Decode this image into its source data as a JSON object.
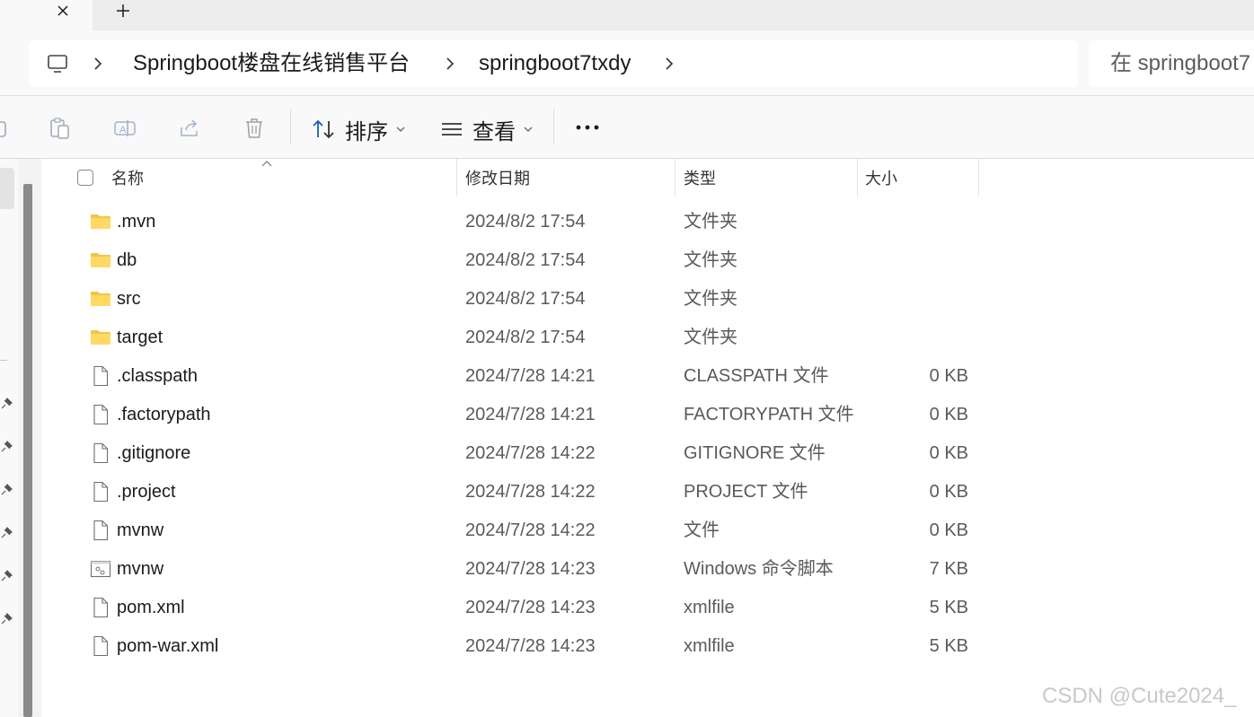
{
  "tabs": {
    "close_glyph": "✕",
    "new_tab_glyph": "+"
  },
  "address": {
    "crumbs": [
      "Springboot楼盘在线销售平台",
      "springboot7txdy"
    ],
    "search_placeholder": "在 springboot7"
  },
  "toolbar": {
    "sort_label": "排序",
    "view_label": "查看",
    "more_label": "···"
  },
  "columns": {
    "name": "名称",
    "modified": "修改日期",
    "type": "类型",
    "size": "大小"
  },
  "files": [
    {
      "name": ".mvn",
      "modified": "2024/8/2 17:54",
      "type": "文件夹",
      "size": "",
      "icon": "folder-icon"
    },
    {
      "name": "db",
      "modified": "2024/8/2 17:54",
      "type": "文件夹",
      "size": "",
      "icon": "folder-icon"
    },
    {
      "name": "src",
      "modified": "2024/8/2 17:54",
      "type": "文件夹",
      "size": "",
      "icon": "folder-icon"
    },
    {
      "name": "target",
      "modified": "2024/8/2 17:54",
      "type": "文件夹",
      "size": "",
      "icon": "folder-icon"
    },
    {
      "name": ".classpath",
      "modified": "2024/7/28 14:21",
      "type": "CLASSPATH 文件",
      "size": "0 KB",
      "icon": "file-icon"
    },
    {
      "name": ".factorypath",
      "modified": "2024/7/28 14:21",
      "type": "FACTORYPATH 文件",
      "size": "0 KB",
      "icon": "file-icon"
    },
    {
      "name": ".gitignore",
      "modified": "2024/7/28 14:22",
      "type": "GITIGNORE 文件",
      "size": "0 KB",
      "icon": "file-icon"
    },
    {
      "name": ".project",
      "modified": "2024/7/28 14:22",
      "type": "PROJECT 文件",
      "size": "0 KB",
      "icon": "file-icon"
    },
    {
      "name": "mvnw",
      "modified": "2024/7/28 14:22",
      "type": "文件",
      "size": "0 KB",
      "icon": "file-icon"
    },
    {
      "name": "mvnw",
      "modified": "2024/7/28 14:23",
      "type": "Windows 命令脚本",
      "size": "7 KB",
      "icon": "script-icon"
    },
    {
      "name": "pom.xml",
      "modified": "2024/7/28 14:23",
      "type": "xmlfile",
      "size": "5 KB",
      "icon": "file-icon"
    },
    {
      "name": "pom-war.xml",
      "modified": "2024/7/28 14:23",
      "type": "xmlfile",
      "size": "5 KB",
      "icon": "file-icon"
    }
  ],
  "watermark": "CSDN @Cute2024_"
}
